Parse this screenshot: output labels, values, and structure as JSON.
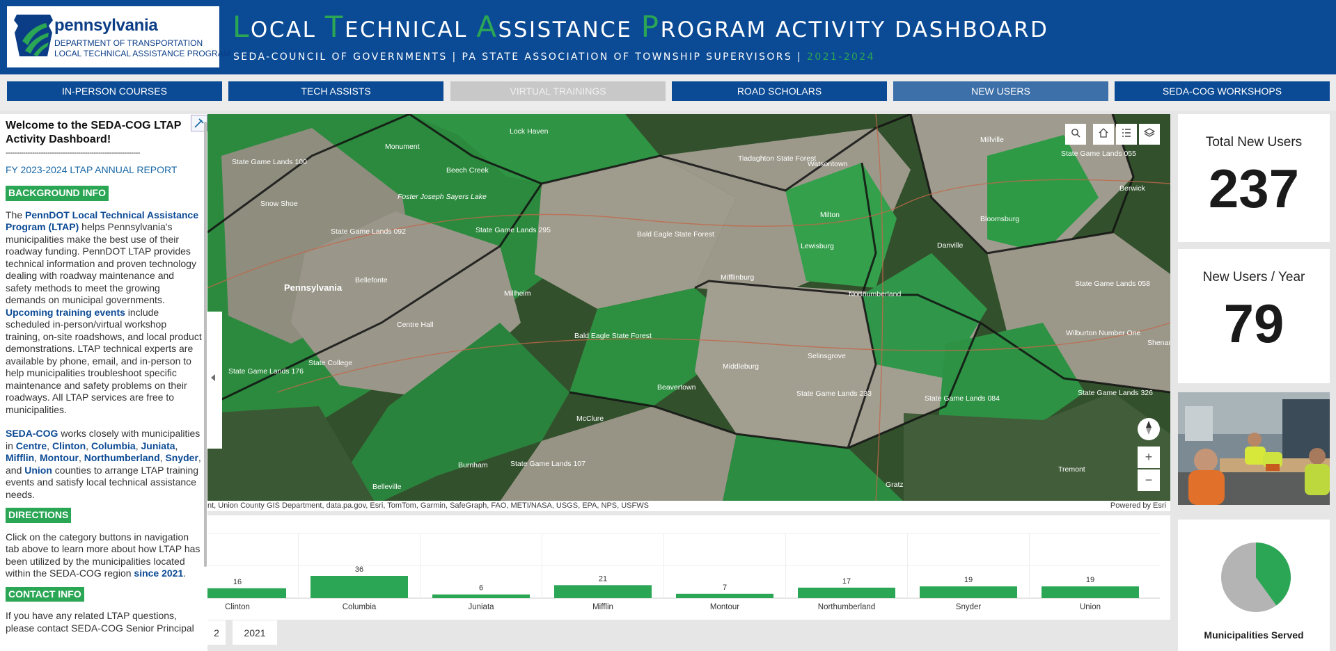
{
  "header": {
    "logo": {
      "name": "pennsylvania",
      "line1": "DEPARTMENT OF TRANSPORTATION",
      "line2": "LOCAL TECHNICAL ASSISTANCE PROGRAM"
    },
    "title_words": [
      {
        "first": "L",
        "rest": "OCAL"
      },
      {
        "first": "T",
        "rest": "ECHNICAL"
      },
      {
        "first": "A",
        "rest": "SSISTANCE"
      },
      {
        "first": "P",
        "rest": "ROGRAM"
      }
    ],
    "title_tail": "ACTIVITY DASHBOARD",
    "subtitle": "SEDA-COUNCIL OF GOVERNMENTS | PA STATE ASSOCIATION OF TOWNSHIP SUPERVISORS |",
    "subtitle_years": "2021-2024"
  },
  "nav": [
    {
      "label": "IN-PERSON COURSES",
      "state": "normal"
    },
    {
      "label": "TECH ASSISTS",
      "state": "normal"
    },
    {
      "label": "VIRTUAL TRAININGS",
      "state": "disabled"
    },
    {
      "label": "ROAD SCHOLARS",
      "state": "normal"
    },
    {
      "label": "NEW USERS",
      "state": "active"
    },
    {
      "label": "SEDA-COG WORKSHOPS",
      "state": "normal"
    }
  ],
  "sidebar": {
    "title": "Welcome to the SEDA-COG LTAP Activity Dashboard!",
    "dashes": "-------------------------------------------------------------",
    "report_link": "FY 2023-2024 LTAP ANNUAL REPORT",
    "background_heading": "BACKGROUND INFO",
    "bg_p1_a": "The ",
    "bg_p1_link": "PennDOT Local Technical Assistance Program (LTAP)",
    "bg_p1_b": " helps Pennsylvania's municipalities make the best use of their roadway funding. PennDOT LTAP provides technical information and proven technology dealing with roadway maintenance and safety methods to meet the growing demands on municipal governments. ",
    "bg_p1_link2": "Upcoming training events",
    "bg_p1_c": " include scheduled in-person/virtual workshop training, on-site roadshows, and local product demonstrations. LTAP technical experts are available by phone, email, and in-person to help municipalities troubleshoot specific maintenance and safety problems on their roadways. All LTAP services are free to municipalities.",
    "bg_p2_link": "SEDA-COG",
    "bg_p2_a": " works closely with municipalities in ",
    "counties": [
      "Centre",
      "Clinton",
      "Columbia",
      "Juniata",
      "Mifflin",
      "Montour",
      "Northumberland",
      "Snyder",
      "Union"
    ],
    "and_word": "and",
    "bg_p2_b": " counties to arrange LTAP training events and satisfy local technical assistance needs.",
    "directions_heading": "DIRECTIONS",
    "dir_a": "Click on the category buttons in navigation tab above to learn more about how LTAP has been utilized by the municipalities located within the SEDA-COG region ",
    "dir_link": "since 2021",
    "dir_end": ".",
    "contact_heading": "CONTACT INFO",
    "contact_text": "If you have any related LTAP questions, please contact SEDA-COG Senior Principal"
  },
  "map": {
    "attribution": "nt, Union County GIS Department, data.pa.gov, Esri, TomTom, Garmin, SafeGraph, FAO, METI/NASA, USGS, EPA, NPS, USFWS",
    "powered_by": "Powered by Esri",
    "labels": [
      "Lock Haven",
      "Monument",
      "Beech Creek",
      "State Game Lands 100",
      "Snow Shoe",
      "Foster Joseph Sayers Lake",
      "State Game Lands 295",
      "State Game Lands 092",
      "Bellefonte",
      "Pennsylvania",
      "Millheim",
      "Centre Hall",
      "State College",
      "State Game Lands 176",
      "Bald Eagle State Forest",
      "Bald Eagle State Forest",
      "Tiadaghton State Forest",
      "Watsontown",
      "Milton",
      "Lewisburg",
      "Mifflinburg",
      "Northumberland",
      "Middleburg",
      "Beavertown",
      "Selinsgrove",
      "State Game Lands 233",
      "McClure",
      "Burnham",
      "State Game Lands 107",
      "Belleville",
      "Millville",
      "Bloomsburg",
      "Danville",
      "State Game Lands 055",
      "Berwick",
      "State Game Lands 058",
      "State Game Lands 084",
      "Wilburton Number One",
      "Shenandoah",
      "State Game Lands 326",
      "Tremont",
      "Gratz"
    ],
    "tools": [
      "search-icon",
      "home-icon",
      "list-icon",
      "layers-icon"
    ],
    "zoom_in": "+",
    "zoom_out": "−"
  },
  "chart_data": {
    "type": "bar",
    "categories": [
      "Clinton",
      "Columbia",
      "Juniata",
      "Mifflin",
      "Montour",
      "Northumberland",
      "Snyder",
      "Union"
    ],
    "values": [
      16,
      36,
      6,
      21,
      7,
      17,
      19,
      19
    ],
    "color": "#2ba655"
  },
  "year_tabs": [
    "2",
    "2021"
  ],
  "stats": {
    "total_label": "Total New Users",
    "total_value": "237",
    "per_year_label": "New Users / Year",
    "per_year_value": "79"
  },
  "pie": {
    "label": "Municipalities Served",
    "served_fraction": 0.4,
    "served_color": "#2ba655",
    "other_color": "#b4b4b4"
  },
  "colors": {
    "brand_blue": "#0b4a94",
    "accent_green": "#2ba655"
  }
}
